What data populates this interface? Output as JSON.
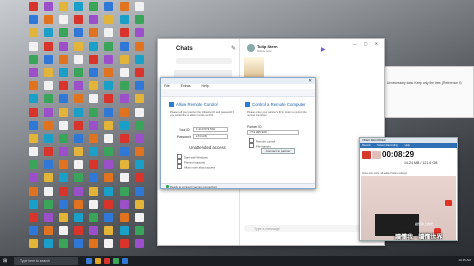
{
  "desktop": {
    "icon_count": 152
  },
  "skype": {
    "title": "Chats",
    "contact_name": "Tulip Stern",
    "contact_status": "Active now",
    "search_placeholder": "Search",
    "chat_name": "Vaith Sewarn",
    "chat_preview": "The quick message preview...",
    "chat_text": "Hi, how are you?",
    "message_placeholder": "Type a message"
  },
  "remote_dialog": {
    "menu": [
      "File",
      "Extras",
      "Help"
    ],
    "allow_title": "Allow Remote Control",
    "allow_desc": "Please tell your partner the following ID and password if you would like to allow remote control.",
    "your_id_label": "Your ID",
    "your_id": "1 210 574 591",
    "password_label": "Password",
    "password": "s74mz8",
    "unattended_title": "Unattended access",
    "unattended_options": [
      "Start with Windows",
      "Prevent inactivity",
      "Allow more about access"
    ],
    "control_title": "Control a Remote Computer",
    "control_desc": "Please enter your partner's ID in order to control the remote computer.",
    "partner_id_label": "Partner ID",
    "partner_id": "774 406 920",
    "remote_control": "Remote control",
    "file_transfer": "File transfer",
    "connect_button": "Connect to partner",
    "footer_status": "Ready to connect (secure connection)"
  },
  "recorder": {
    "header": "VIDEO RECORDER",
    "tabs": [
      "Record",
      "Screen Recording",
      "Help"
    ],
    "timer": "00:08:29",
    "size": "14.24 MB / 121.6 GB",
    "info": "Video sub tools: all added Video settings",
    "video_text_chinese": "讀懂我 · 讀懂世界",
    "video_side_text": "讀懂身上的光"
  },
  "taskbar": {
    "search_placeholder": "Type here to search",
    "clock": "10:45 AM"
  },
  "background_window": {
    "text": "Unnecessary data. Keep only the tree: (Reference 4)"
  }
}
